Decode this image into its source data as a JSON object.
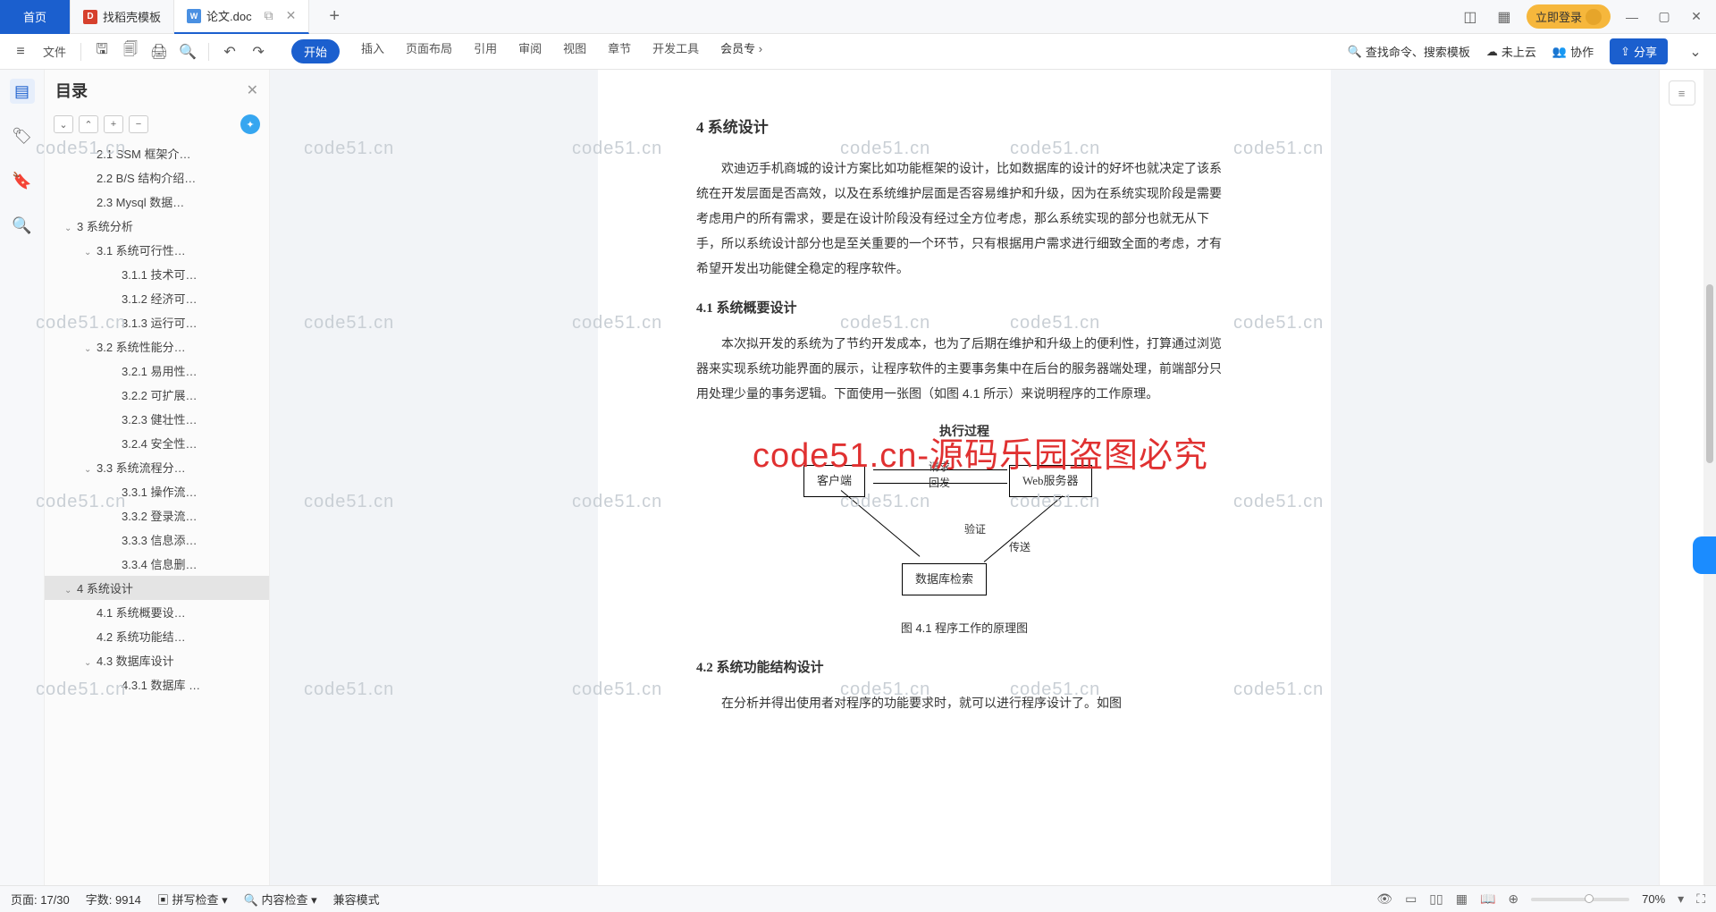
{
  "tabs": {
    "home": "首页",
    "t1": "找稻壳模板",
    "t2": "论文.doc"
  },
  "titleRight": {
    "login": "立即登录"
  },
  "toolbar": {
    "file": "文件",
    "menus": [
      "开始",
      "插入",
      "页面布局",
      "引用",
      "审阅",
      "视图",
      "章节",
      "开发工具",
      "会员专"
    ],
    "search": "查找命令、搜索模板",
    "cloud": "未上云",
    "coop": "协作",
    "share": "分享"
  },
  "sidebar": {
    "title": "目录",
    "items": [
      {
        "lv": 2,
        "t": "2.1 SSM 框架介…"
      },
      {
        "lv": 2,
        "t": "2.2 B/S 结构介绍…"
      },
      {
        "lv": 2,
        "t": "2.3 Mysql 数据…"
      },
      {
        "lv": 1,
        "t": "3  系统分析",
        "chev": "⌄"
      },
      {
        "lv": 2,
        "t": "3.1 系统可行性…",
        "chev": "⌄"
      },
      {
        "lv": 3,
        "t": "3.1.1 技术可…"
      },
      {
        "lv": 3,
        "t": "3.1.2 经济可…"
      },
      {
        "lv": 3,
        "t": "3.1.3 运行可…"
      },
      {
        "lv": 2,
        "t": "3.2 系统性能分…",
        "chev": "⌄"
      },
      {
        "lv": 3,
        "t": "3.2.1 易用性…"
      },
      {
        "lv": 3,
        "t": "3.2.2 可扩展…"
      },
      {
        "lv": 3,
        "t": "3.2.3 健壮性…"
      },
      {
        "lv": 3,
        "t": "3.2.4 安全性…"
      },
      {
        "lv": 2,
        "t": "3.3 系统流程分…",
        "chev": "⌄"
      },
      {
        "lv": 3,
        "t": "3.3.1 操作流…"
      },
      {
        "lv": 3,
        "t": "3.3.2 登录流…"
      },
      {
        "lv": 3,
        "t": "3.3.3 信息添…"
      },
      {
        "lv": 3,
        "t": "3.3.4 信息删…"
      },
      {
        "lv": 1,
        "t": "4  系统设计",
        "chev": "⌄",
        "sel": true
      },
      {
        "lv": 2,
        "t": "4.1 系统概要设…"
      },
      {
        "lv": 2,
        "t": "4.2 系统功能结…"
      },
      {
        "lv": 2,
        "t": "4.3 数据库设计",
        "chev": "⌄"
      },
      {
        "lv": 3,
        "t": "4.3.1 数据库 …"
      }
    ]
  },
  "doc": {
    "h2": "4  系统设计",
    "p1": "欢迪迈手机商城的设计方案比如功能框架的设计，比如数据库的设计的好坏也就决定了该系统在开发层面是否高效，以及在系统维护层面是否容易维护和升级，因为在系统实现阶段是需要考虑用户的所有需求，要是在设计阶段没有经过全方位考虑，那么系统实现的部分也就无从下手，所以系统设计部分也是至关重要的一个环节，只有根据用户需求进行细致全面的考虑，才有希望开发出功能健全稳定的程序软件。",
    "h31": "4.1  系统概要设计",
    "p2": "本次拟开发的系统为了节约开发成本，也为了后期在维护和升级上的便利性，打算通过浏览器来实现系统功能界面的展示，让程序软件的主要事务集中在后台的服务器端处理，前端部分只用处理少量的事务逻辑。下面使用一张图（如图 4.1 所示）来说明程序的工作原理。",
    "center": "执行过程",
    "dbox1": "客户端",
    "dbox2": "Web服务器",
    "dbox3": "数据库检索",
    "dl1": "请求",
    "dl2": "回发",
    "dl3": "验证",
    "dl4": "传送",
    "caption": "图 4.1  程序工作的原理图",
    "h32": "4.2  系统功能结构设计",
    "p3": "在分析并得出使用者对程序的功能要求时，就可以进行程序设计了。如图"
  },
  "status": {
    "page": "页面: 17/30",
    "words": "字数: 9914",
    "spell": "拼写检查",
    "content": "内容检查",
    "compat": "兼容模式",
    "zoom": "70%"
  },
  "watermark": "code51.cn",
  "bigmark": "code51.cn-源码乐园盗图必究"
}
